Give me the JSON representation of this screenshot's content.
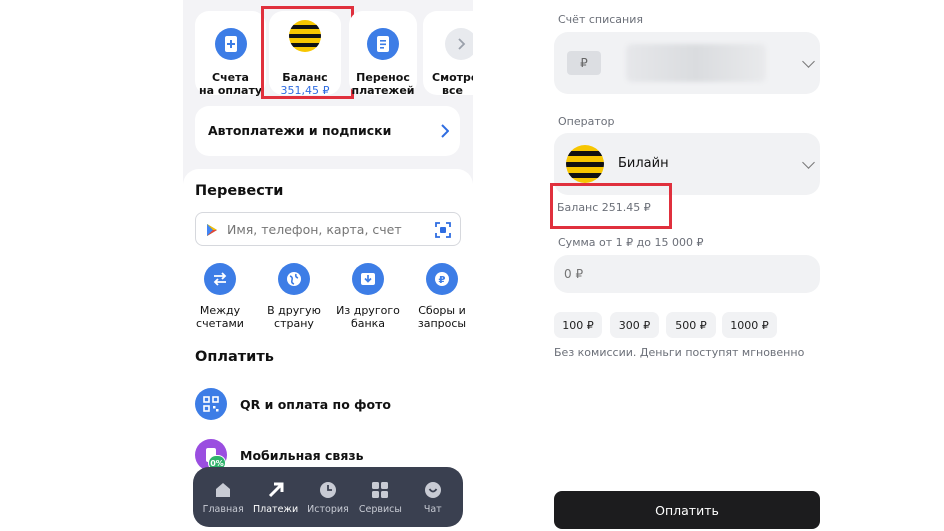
{
  "left": {
    "quick_actions": [
      {
        "label_line1": "Счета",
        "label_line2": "на оплату",
        "icon": "invoice-icon"
      },
      {
        "label_line1": "Баланс",
        "label_line2": "351,45 ₽",
        "icon": "beeline-logo-icon"
      },
      {
        "label_line1": "Перенос",
        "label_line2": "платежей",
        "icon": "document-transfer-icon"
      },
      {
        "label_line1": "Смотре",
        "label_line2": "все",
        "icon": "chevron-right-icon"
      }
    ],
    "autopay": {
      "label": "Автоплатежи и подписки"
    },
    "transfer": {
      "title": "Перевести",
      "search_placeholder": "Имя, телефон, карта, счет",
      "items": [
        {
          "line1": "Между",
          "line2": "счетами",
          "icon": "swap-arrows-icon"
        },
        {
          "line1": "В другую",
          "line2": "страну",
          "icon": "globe-icon"
        },
        {
          "line1": "Из другого",
          "line2": "банка",
          "icon": "bank-download-icon"
        },
        {
          "line1": "Сборы и",
          "line2": "запросы",
          "icon": "ruble-coin-icon"
        }
      ]
    },
    "pay": {
      "title": "Оплатить",
      "items": [
        {
          "label": "QR и оплата по фото",
          "icon": "qr-icon"
        },
        {
          "label": "Мобильная связь",
          "icon": "phone-icon",
          "badge": "0%"
        }
      ]
    },
    "tabbar": [
      {
        "label": "Главная",
        "icon": "home-icon",
        "active": false
      },
      {
        "label": "Платежи",
        "icon": "payments-arrow-icon",
        "active": true
      },
      {
        "label": "История",
        "icon": "clock-icon",
        "active": false
      },
      {
        "label": "Сервисы",
        "icon": "grid-icon",
        "active": false
      },
      {
        "label": "Чат",
        "icon": "chat-icon",
        "active": false
      }
    ]
  },
  "right": {
    "debit_account_label": "Счёт списания",
    "currency_symbol": "₽",
    "operator_label": "Оператор",
    "operator_name": "Билайн",
    "balance_text": "Баланс 251.45 ₽",
    "amount_hint": "Сумма от 1 ₽ до 15 000 ₽",
    "amount_placeholder": "0 ₽",
    "chips": [
      "100 ₽",
      "300 ₽",
      "500 ₽",
      "1000 ₽"
    ],
    "commission_note": "Без комиссии. Деньги поступят мгновенно",
    "pay_button": "Оплатить"
  },
  "colors": {
    "accent_blue": "#3d7de6",
    "highlight_red": "#e0303d",
    "beeline_yellow": "#f7c600",
    "tabbar_bg": "#3a4050",
    "pay_button_bg": "#1c1c1e"
  }
}
